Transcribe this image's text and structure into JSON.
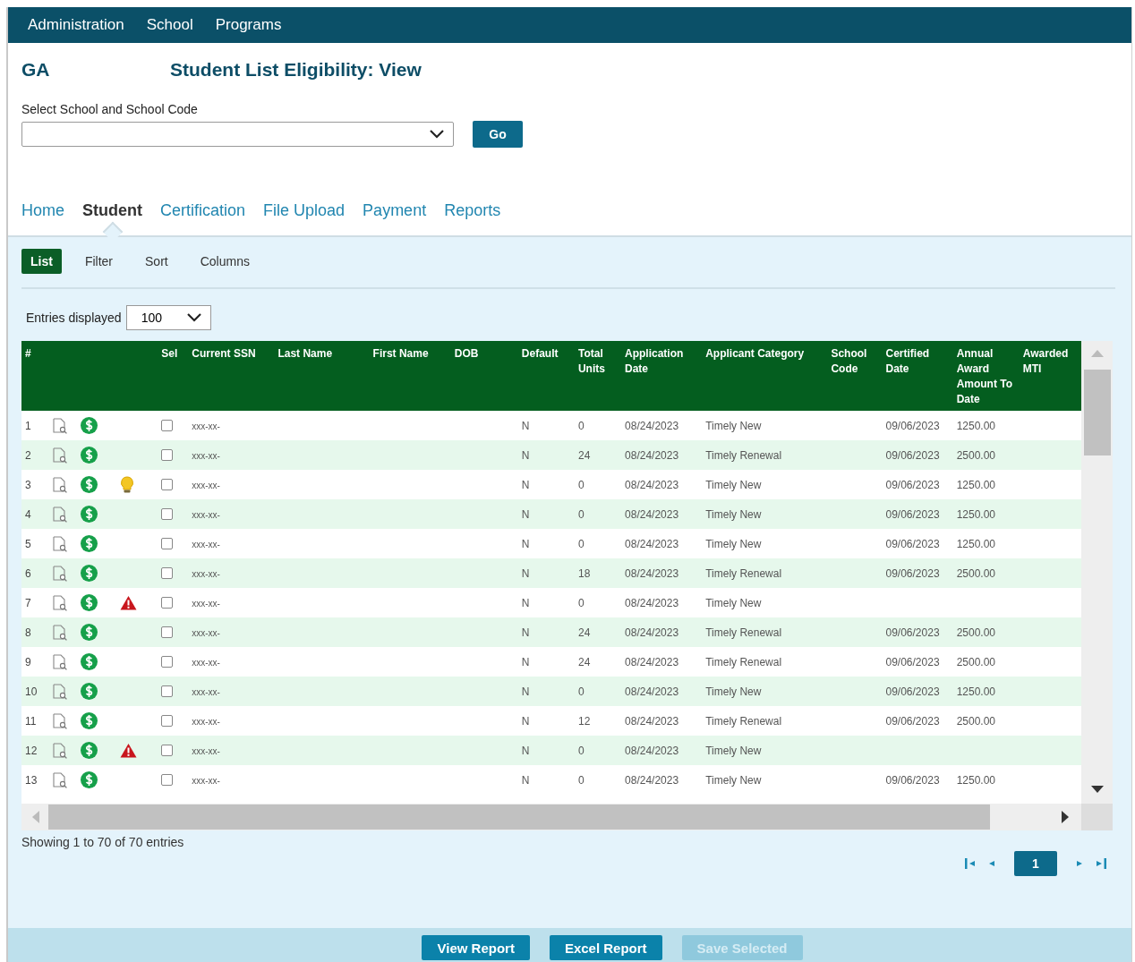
{
  "top_menu": [
    "Administration",
    "School",
    "Programs"
  ],
  "agency": "GA",
  "page_title": "Student List Eligibility: View",
  "school_select": {
    "label": "Select School and School Code",
    "go_button": "Go"
  },
  "tabs": [
    {
      "label": "Home",
      "selected": false
    },
    {
      "label": "Student",
      "selected": true
    },
    {
      "label": "Certification",
      "selected": false
    },
    {
      "label": "File Upload",
      "selected": false
    },
    {
      "label": "Payment",
      "selected": false
    },
    {
      "label": "Reports",
      "selected": false
    }
  ],
  "subtabs": [
    {
      "label": "List",
      "selected": true
    },
    {
      "label": "Filter",
      "selected": false
    },
    {
      "label": "Sort",
      "selected": false
    },
    {
      "label": "Columns",
      "selected": false
    }
  ],
  "entries_displayed": {
    "label": "Entries displayed",
    "value": "100"
  },
  "table": {
    "columns": [
      "#",
      "",
      "",
      "",
      "Sel",
      "Current SSN",
      "Last Name",
      "First Name",
      "DOB",
      "Default",
      "Total Units",
      "Application Date",
      "Applicant Category",
      "School Code",
      "Certified Date",
      "Annual Award Amount To Date",
      "Awarded MTI"
    ],
    "rows": [
      {
        "num": "1",
        "tip": false,
        "warning": false,
        "selected": false,
        "ssn": "xxx-xx-",
        "default": "N",
        "units": "0",
        "app_date": "08/24/2023",
        "category": "Timely New",
        "cert_date": "09/06/2023",
        "amount": "1250.00"
      },
      {
        "num": "2",
        "tip": false,
        "warning": false,
        "selected": false,
        "ssn": "xxx-xx-",
        "default": "N",
        "units": "24",
        "app_date": "08/24/2023",
        "category": "Timely Renewal",
        "cert_date": "09/06/2023",
        "amount": "2500.00"
      },
      {
        "num": "3",
        "tip": true,
        "warning": false,
        "selected": false,
        "ssn": "xxx-xx-",
        "default": "N",
        "units": "0",
        "app_date": "08/24/2023",
        "category": "Timely New",
        "cert_date": "09/06/2023",
        "amount": "1250.00"
      },
      {
        "num": "4",
        "tip": false,
        "warning": false,
        "selected": false,
        "ssn": "xxx-xx-",
        "default": "N",
        "units": "0",
        "app_date": "08/24/2023",
        "category": "Timely New",
        "cert_date": "09/06/2023",
        "amount": "1250.00"
      },
      {
        "num": "5",
        "tip": false,
        "warning": false,
        "selected": false,
        "ssn": "xxx-xx-",
        "default": "N",
        "units": "0",
        "app_date": "08/24/2023",
        "category": "Timely New",
        "cert_date": "09/06/2023",
        "amount": "1250.00"
      },
      {
        "num": "6",
        "tip": false,
        "warning": false,
        "selected": false,
        "ssn": "xxx-xx-",
        "default": "N",
        "units": "18",
        "app_date": "08/24/2023",
        "category": "Timely Renewal",
        "cert_date": "09/06/2023",
        "amount": "2500.00"
      },
      {
        "num": "7",
        "tip": false,
        "warning": true,
        "selected": false,
        "ssn": "xxx-xx-",
        "default": "N",
        "units": "0",
        "app_date": "08/24/2023",
        "category": "Timely New"
      },
      {
        "num": "8",
        "tip": false,
        "warning": false,
        "selected": false,
        "ssn": "xxx-xx-",
        "default": "N",
        "units": "24",
        "app_date": "08/24/2023",
        "category": "Timely Renewal",
        "cert_date": "09/06/2023",
        "amount": "2500.00"
      },
      {
        "num": "9",
        "tip": false,
        "warning": false,
        "selected": false,
        "ssn": "xxx-xx-",
        "default": "N",
        "units": "24",
        "app_date": "08/24/2023",
        "category": "Timely Renewal",
        "cert_date": "09/06/2023",
        "amount": "2500.00"
      },
      {
        "num": "10",
        "tip": false,
        "warning": false,
        "selected": false,
        "ssn": "xxx-xx-",
        "default": "N",
        "units": "0",
        "app_date": "08/24/2023",
        "category": "Timely New",
        "cert_date": "09/06/2023",
        "amount": "1250.00"
      },
      {
        "num": "11",
        "tip": false,
        "warning": false,
        "selected": false,
        "ssn": "xxx-xx-",
        "default": "N",
        "units": "12",
        "app_date": "08/24/2023",
        "category": "Timely Renewal",
        "cert_date": "09/06/2023",
        "amount": "2500.00"
      },
      {
        "num": "12",
        "tip": false,
        "warning": true,
        "selected": false,
        "ssn": "xxx-xx-",
        "default": "N",
        "units": "0",
        "app_date": "08/24/2023",
        "category": "Timely New"
      },
      {
        "num": "13",
        "tip": false,
        "warning": false,
        "selected": false,
        "ssn": "xxx-xx-",
        "default": "N",
        "units": "0",
        "app_date": "08/24/2023",
        "category": "Timely New",
        "cert_date": "09/06/2023",
        "amount": "1250.00"
      }
    ]
  },
  "summary": "Showing 1 to 70 of 70 entries",
  "pages": [
    {
      "label": "1",
      "selected": true
    }
  ],
  "buttons": [
    {
      "label": "View Report",
      "disabled": false
    },
    {
      "label": "Excel Report",
      "disabled": false
    },
    {
      "label": "Save Selected",
      "disabled": true
    }
  ]
}
